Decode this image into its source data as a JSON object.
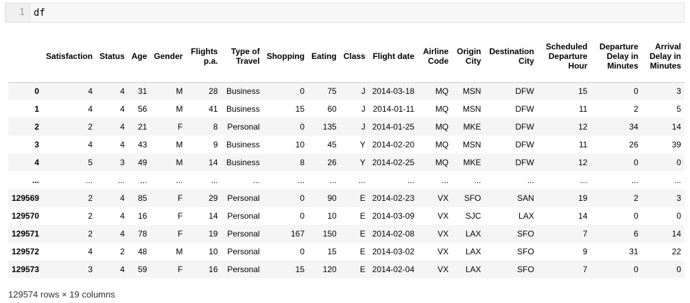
{
  "cell": {
    "line_number": "1",
    "code": "df"
  },
  "table": {
    "columns": [
      "",
      "Satisfaction",
      "Status",
      "Age",
      "Gender",
      "Flights p.a.",
      "Type of Travel",
      "Shopping",
      "Eating",
      "Class",
      "Flight date",
      "Airline Code",
      "Origin City",
      "Destination City",
      "Scheduled Departure Hour",
      "Departure Delay in Minutes",
      "Arrival Delay in Minutes"
    ],
    "rows": [
      [
        "0",
        "4",
        "4",
        "31",
        "M",
        "28",
        "Business",
        "0",
        "75",
        "J",
        "2014-03-18",
        "MQ",
        "MSN",
        "DFW",
        "15",
        "0",
        "3"
      ],
      [
        "1",
        "4",
        "4",
        "56",
        "M",
        "41",
        "Business",
        "15",
        "60",
        "J",
        "2014-01-11",
        "MQ",
        "MSN",
        "DFW",
        "11",
        "2",
        "5"
      ],
      [
        "2",
        "2",
        "4",
        "21",
        "F",
        "8",
        "Personal",
        "0",
        "135",
        "J",
        "2014-01-25",
        "MQ",
        "MKE",
        "DFW",
        "12",
        "34",
        "14"
      ],
      [
        "3",
        "4",
        "4",
        "43",
        "M",
        "9",
        "Business",
        "10",
        "45",
        "Y",
        "2014-02-20",
        "MQ",
        "MSN",
        "DFW",
        "11",
        "26",
        "39"
      ],
      [
        "4",
        "5",
        "3",
        "49",
        "M",
        "14",
        "Business",
        "8",
        "26",
        "Y",
        "2014-02-25",
        "MQ",
        "MKE",
        "DFW",
        "12",
        "0",
        "0"
      ],
      [
        "...",
        "...",
        "...",
        "...",
        "...",
        "...",
        "...",
        "...",
        "...",
        "...",
        "...",
        "...",
        "...",
        "...",
        "...",
        "...",
        "..."
      ],
      [
        "129569",
        "2",
        "4",
        "85",
        "F",
        "29",
        "Personal",
        "0",
        "90",
        "E",
        "2014-02-23",
        "VX",
        "SFO",
        "SAN",
        "19",
        "2",
        "3"
      ],
      [
        "129570",
        "2",
        "4",
        "16",
        "F",
        "14",
        "Personal",
        "0",
        "10",
        "E",
        "2014-03-09",
        "VX",
        "SJC",
        "LAX",
        "14",
        "0",
        "0"
      ],
      [
        "129571",
        "2",
        "4",
        "78",
        "F",
        "19",
        "Personal",
        "167",
        "150",
        "E",
        "2014-02-08",
        "VX",
        "LAX",
        "SFO",
        "7",
        "6",
        "14"
      ],
      [
        "129572",
        "4",
        "2",
        "48",
        "M",
        "10",
        "Personal",
        "0",
        "15",
        "E",
        "2014-03-02",
        "VX",
        "LAX",
        "SFO",
        "9",
        "31",
        "22"
      ],
      [
        "129573",
        "3",
        "4",
        "59",
        "F",
        "16",
        "Personal",
        "15",
        "120",
        "E",
        "2014-02-04",
        "VX",
        "LAX",
        "SFO",
        "7",
        "0",
        "0"
      ]
    ]
  },
  "footer": {
    "shape": "129574 rows × 19 columns"
  }
}
